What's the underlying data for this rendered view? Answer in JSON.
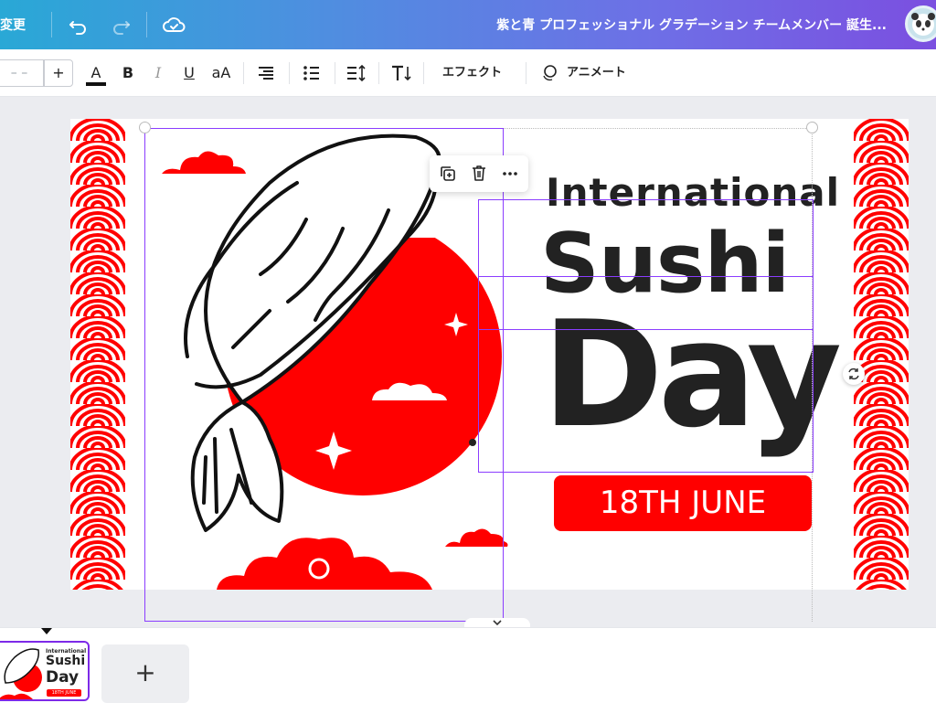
{
  "topbar": {
    "resize_label": "変更",
    "document_title": "紫と青 プロフェッショナル グラデーション チームメンバー 誕生..."
  },
  "toolbar": {
    "font_size": "– –",
    "plus_label": "+",
    "bold_label": "B",
    "italic_label": "I",
    "underline_label": "U",
    "case_label": "aA",
    "effects_label": "エフェクト",
    "animate_label": "アニメート"
  },
  "design": {
    "line1": "International",
    "line2": "Sushi",
    "line3": "Day",
    "date": "18TH JUNE",
    "accent": "#ff0000"
  },
  "thumbnail": {
    "line1": "International",
    "line2": "Sushi",
    "line3": "Day",
    "date": "18TH JUNE"
  },
  "pages": {
    "add_label": "+"
  },
  "colors": {
    "selection": "#8b3dff",
    "canvas_background": "#ebecf0"
  }
}
